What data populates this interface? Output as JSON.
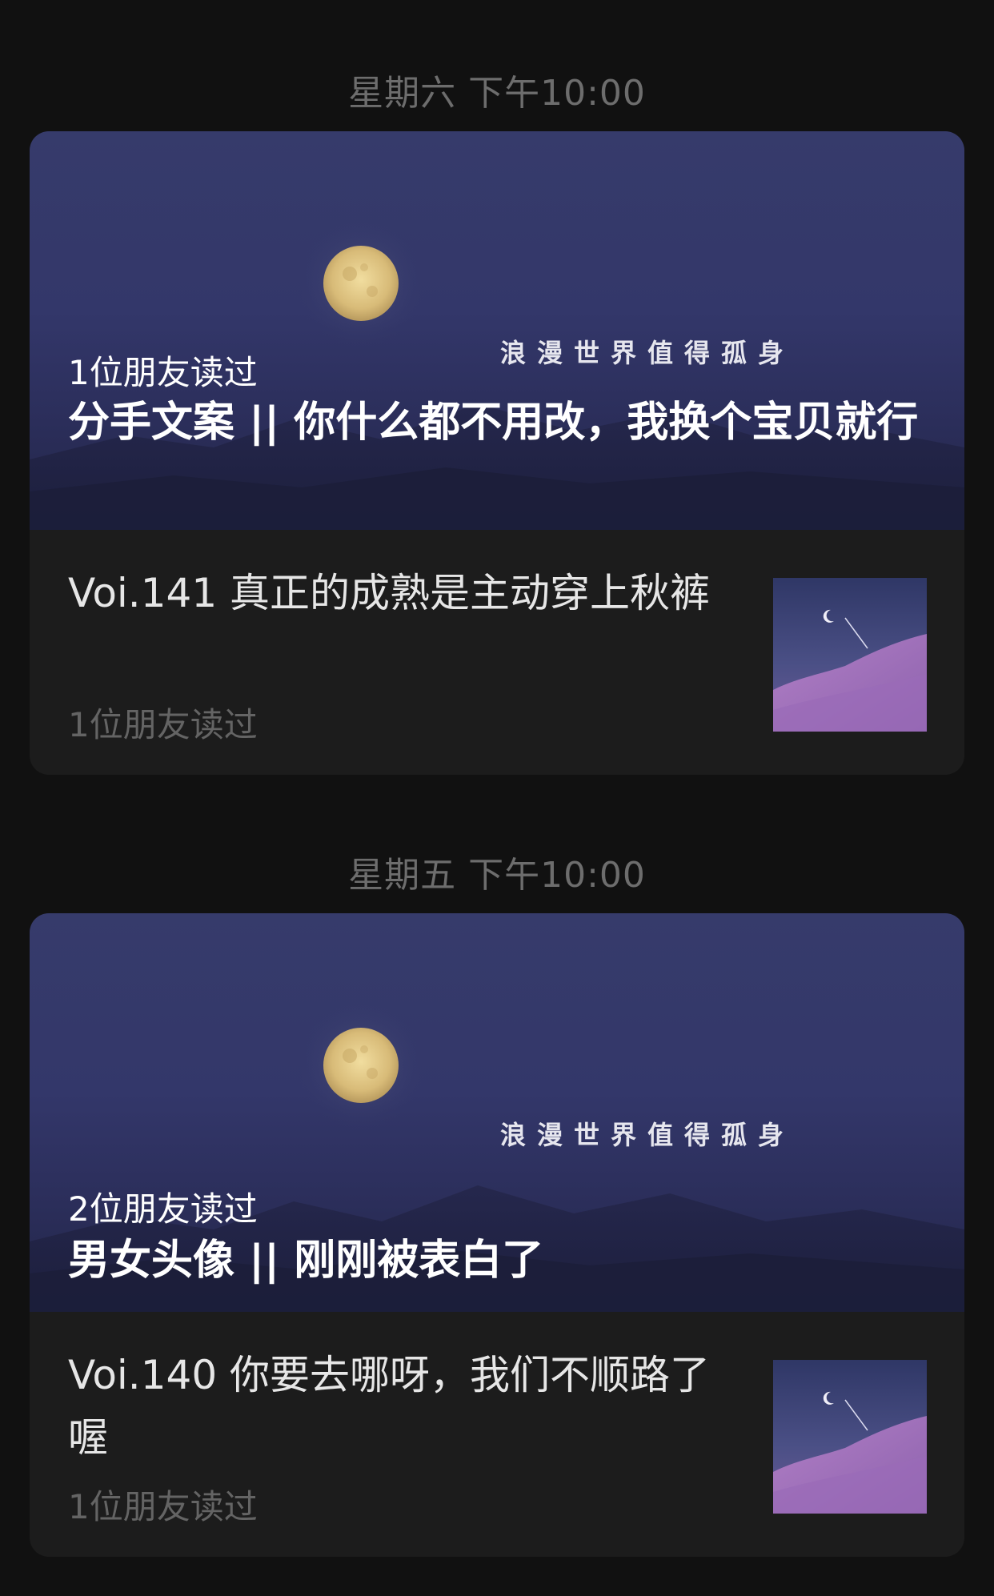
{
  "feed": {
    "groups": [
      {
        "time": "星期六 下午10:00",
        "main": {
          "read_count": "1位朋友读过",
          "title": "分手文案 || 你什么都不用改，我换个宝贝就行",
          "cover_caption": "浪漫世界值得孤身"
        },
        "sub": {
          "title": "Voi.141 真正的成熟是主动穿上秋裤",
          "read_count": "1位朋友读过"
        }
      },
      {
        "time": "星期五 下午10:00",
        "main": {
          "read_count": "2位朋友读过",
          "title": "男女头像 || 刚刚被表白了",
          "cover_caption": "浪漫世界值得孤身"
        },
        "sub": {
          "title": "Voi.140 你要去哪呀，我们不顺路了喔",
          "read_count": "1位朋友读过"
        }
      }
    ]
  },
  "colors": {
    "background": "#111111",
    "card": "#1c1c1c",
    "timestamp": "#6d6d6d",
    "cover_sky": "#363b6b",
    "muted_text": "#646464"
  }
}
